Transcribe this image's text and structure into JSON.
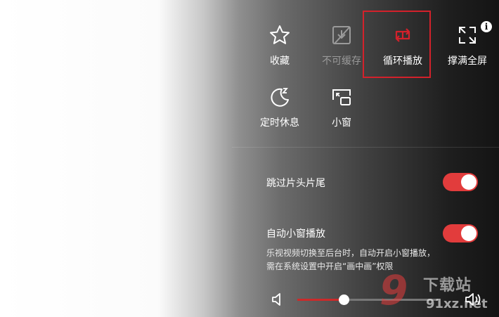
{
  "actions": [
    {
      "id": "favorite",
      "label": "收藏",
      "icon": "star-icon",
      "enabled": true
    },
    {
      "id": "no-cache",
      "label": "不可缓存",
      "icon": "no-download-icon",
      "enabled": false
    },
    {
      "id": "loop",
      "label": "循环播放",
      "icon": "loop-icon",
      "enabled": true,
      "highlighted": true,
      "icon_color": "#d3212b"
    },
    {
      "id": "fill-screen",
      "label": "撑满全屏",
      "icon": "expand-icon",
      "enabled": true
    },
    {
      "id": "sleep-timer",
      "label": "定时休息",
      "icon": "moon-sleep-icon",
      "enabled": true
    },
    {
      "id": "mini-window",
      "label": "小窗",
      "icon": "picture-in-picture-icon",
      "enabled": true
    }
  ],
  "info_badge": "i",
  "settings": {
    "skip_intro": {
      "label": "跳过片头片尾",
      "on": true
    },
    "auto_mini": {
      "label": "自动小窗播放",
      "on": true,
      "description": "乐视视频切换至后台时，自动开启小窗播放，需在系统设置中开启“画中画”权限"
    }
  },
  "volume": {
    "level": 0.33,
    "min_icon": "volume-low-icon",
    "max_icon": "volume-high-icon"
  },
  "watermark": {
    "glyph": "9",
    "site": "下载站",
    "url": "91xz.net"
  },
  "colors": {
    "accent": "#e23c3c",
    "highlight_border": "#d3212b"
  }
}
